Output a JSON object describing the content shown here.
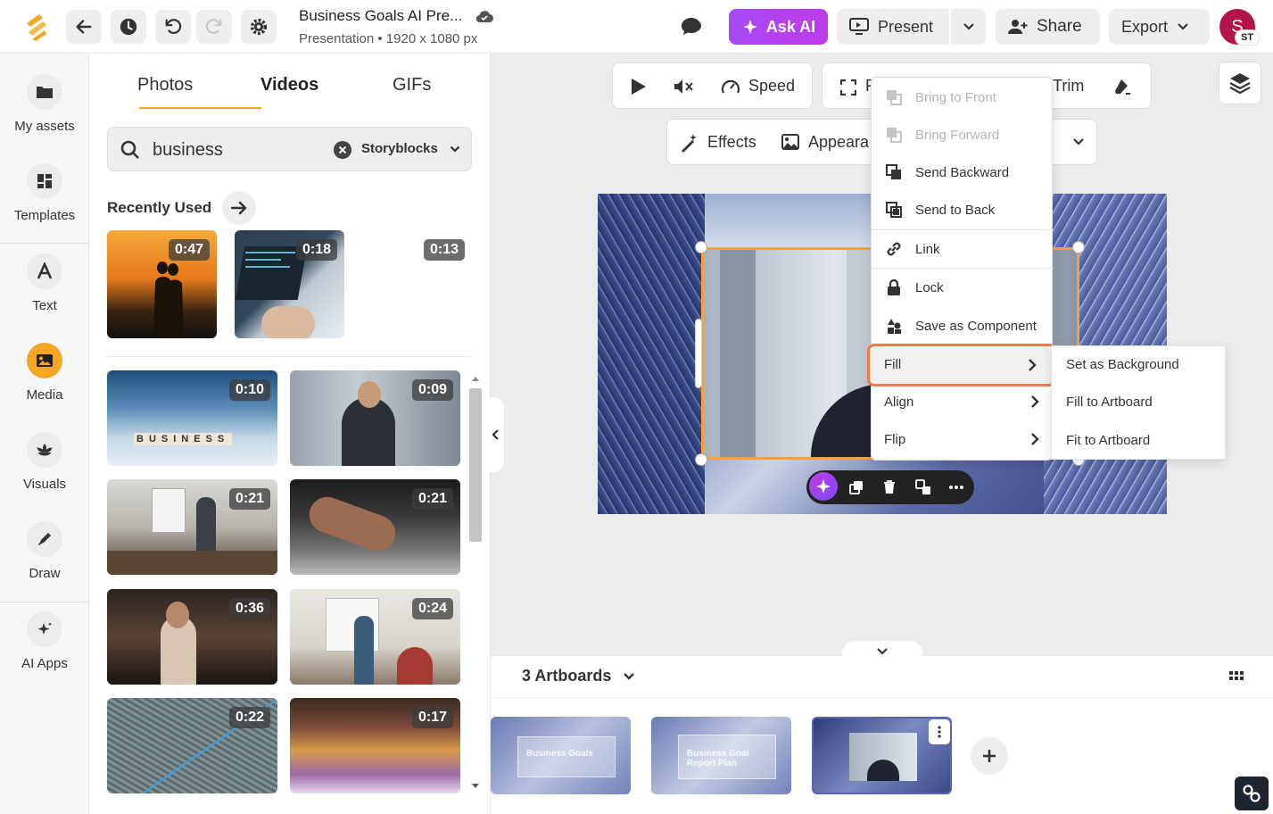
{
  "header": {
    "doc_title": "Business Goals AI Pre...",
    "doc_subtitle": "Presentation • 1920 x 1080 px",
    "ask_ai_label": "Ask AI",
    "present_label": "Present",
    "share_label": "Share",
    "export_label": "Export",
    "avatar_initial": "S",
    "avatar_badge": "ST",
    "accent_color": "#f5a623",
    "ask_ai_color": "#b044ee"
  },
  "nav": {
    "items": [
      {
        "label": "My assets",
        "icon": "folder-icon"
      },
      {
        "label": "Templates",
        "icon": "templates-icon"
      },
      {
        "label": "Text",
        "icon": "text-icon"
      },
      {
        "label": "Media",
        "icon": "media-icon",
        "active": true
      },
      {
        "label": "Visuals",
        "icon": "visuals-icon"
      },
      {
        "label": "Draw",
        "icon": "pen-icon"
      },
      {
        "label": "AI Apps",
        "icon": "sparkle-icon"
      }
    ]
  },
  "panel": {
    "tabs": [
      "Photos",
      "Videos",
      "GIFs"
    ],
    "active_tab": "Videos",
    "search_value": "business",
    "search_source": "Storyblocks",
    "recently_used_title": "Recently Used",
    "recent": [
      {
        "duration": "0:47"
      },
      {
        "duration": "0:18"
      },
      {
        "duration": "0:13"
      }
    ],
    "videos": [
      {
        "duration": "0:10"
      },
      {
        "duration": "0:09"
      },
      {
        "duration": "0:21"
      },
      {
        "duration": "0:21"
      },
      {
        "duration": "0:36"
      },
      {
        "duration": "0:24"
      },
      {
        "duration": "0:22"
      },
      {
        "duration": "0:17"
      }
    ],
    "business_tiles": "BUSINESS"
  },
  "toolbar": {
    "speed_label": "Speed",
    "fit_label_fragment": "F",
    "trim_label": "Trim",
    "effects_label": "Effects",
    "appearance_label": "Appeara"
  },
  "context_menu": {
    "items": [
      {
        "label": "Bring to Front",
        "disabled": true
      },
      {
        "label": "Bring Forward",
        "disabled": true
      },
      {
        "label": "Send Backward",
        "disabled": false
      },
      {
        "label": "Send to Back",
        "disabled": false
      },
      {
        "label": "Link",
        "disabled": false
      },
      {
        "label": "Lock",
        "disabled": false
      },
      {
        "label": "Save as Component",
        "disabled": false
      },
      {
        "label": "Fill",
        "submenu": true,
        "highlighted": true
      },
      {
        "label": "Align",
        "submenu": true
      },
      {
        "label": "Flip",
        "submenu": true
      }
    ],
    "fill_submenu": [
      "Set as Background",
      "Fill to Artboard",
      "Fit to Artboard"
    ]
  },
  "bottom": {
    "artboards_label": "3 Artboards",
    "thumbs": [
      {
        "text": "Business Goals"
      },
      {
        "text": "Business Goal Report Plan"
      },
      {
        "text": ""
      }
    ]
  }
}
